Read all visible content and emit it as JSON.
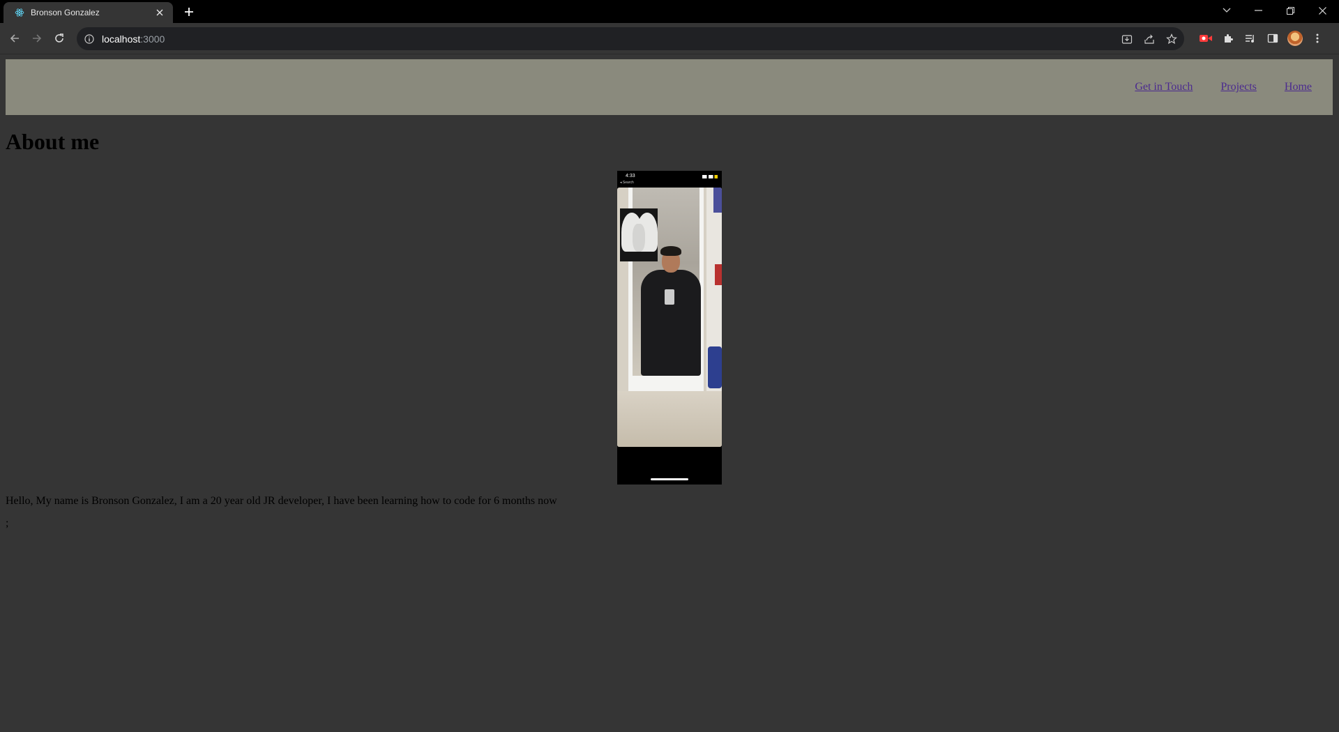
{
  "browser": {
    "tab_title": "Bronson Gonzalez",
    "url_host": "localhost",
    "url_port": ":3000"
  },
  "site": {
    "nav": [
      {
        "label": "Get in Touch"
      },
      {
        "label": "Projects"
      },
      {
        "label": "Home"
      }
    ],
    "heading": "About me",
    "photo": {
      "time": "4:33",
      "back_label": "◂ Search"
    },
    "intro": "Hello, My name is Bronson Gonzalez, I am a 20 year old JR developer, I have been learning how to code for 6 months now",
    "trailing": ";"
  },
  "colors": {
    "page_background": "#353535",
    "header_background": "#8a8a7d",
    "link": "#4b2a8f"
  },
  "icons": {
    "tab_favicon": "react-logo-icon",
    "extension": "puzzle-piece-icon"
  }
}
